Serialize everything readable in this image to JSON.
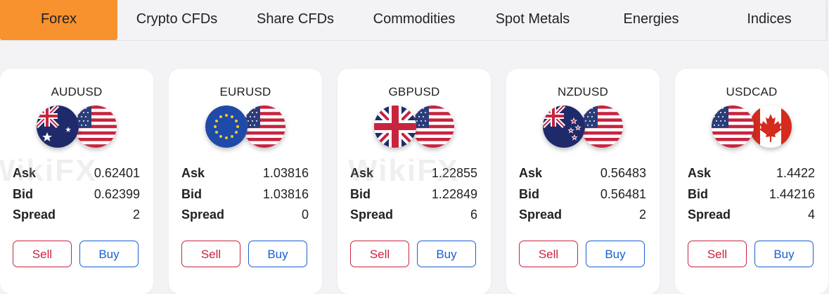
{
  "tabs": [
    {
      "label": "Forex",
      "active": true
    },
    {
      "label": "Crypto CFDs",
      "active": false
    },
    {
      "label": "Share CFDs",
      "active": false
    },
    {
      "label": "Commodities",
      "active": false
    },
    {
      "label": "Spot Metals",
      "active": false
    },
    {
      "label": "Energies",
      "active": false
    },
    {
      "label": "Indices",
      "active": false
    }
  ],
  "labels": {
    "ask": "Ask",
    "bid": "Bid",
    "spread": "Spread",
    "sell": "Sell",
    "buy": "Buy"
  },
  "watermark": "WikiFX",
  "cards": [
    {
      "pair": "AUDUSD",
      "ask": "0.62401",
      "bid": "0.62399",
      "spread": "2",
      "flags": [
        "australia-flag-icon",
        "usa-flag-icon"
      ]
    },
    {
      "pair": "EURUSD",
      "ask": "1.03816",
      "bid": "1.03816",
      "spread": "0",
      "flags": [
        "eu-flag-icon",
        "usa-flag-icon"
      ]
    },
    {
      "pair": "GBPUSD",
      "ask": "1.22855",
      "bid": "1.22849",
      "spread": "6",
      "flags": [
        "uk-flag-icon",
        "usa-flag-icon"
      ]
    },
    {
      "pair": "NZDUSD",
      "ask": "0.56483",
      "bid": "0.56481",
      "spread": "2",
      "flags": [
        "new-zealand-flag-icon",
        "usa-flag-icon"
      ]
    },
    {
      "pair": "USDCAD",
      "ask": "1.4422",
      "bid": "1.44216",
      "spread": "4",
      "flags": [
        "usa-flag-icon",
        "canada-flag-icon"
      ]
    }
  ],
  "colors": {
    "active_tab": "#f7922e",
    "sell": "#c8243f",
    "buy": "#1a5fd0",
    "background": "#f3f3f5"
  }
}
